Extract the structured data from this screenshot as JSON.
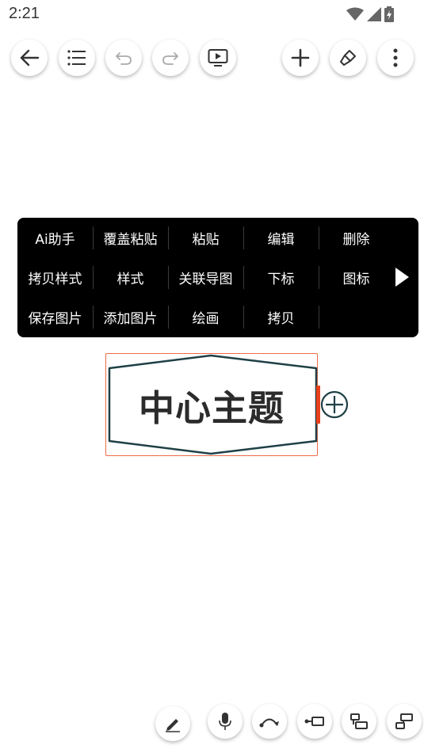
{
  "status": {
    "time": "2:21",
    "icons": [
      "wifi-icon",
      "cell-signal-icon",
      "battery-icon"
    ]
  },
  "toolbar": {
    "buttons": [
      "back-icon",
      "outline-list-icon",
      "undo-icon",
      "redo-icon",
      "present-icon",
      "add-icon",
      "format-brush-icon",
      "more-vert-icon"
    ]
  },
  "context_menu": {
    "rows": [
      [
        "Ai助手",
        "覆盖粘贴",
        "粘贴",
        "编辑",
        "删除"
      ],
      [
        "拷贝样式",
        "样式",
        "关联导图",
        "下标",
        "图标"
      ],
      [
        "保存图片",
        "添加图片",
        "绘画",
        "拷贝"
      ]
    ],
    "more_icon": "triangle-right-icon"
  },
  "node": {
    "text": "中心主题",
    "colors": {
      "border": "#1f4046",
      "selection": "#f06a4a",
      "handle": "#e8401c"
    }
  },
  "bottom_bar": {
    "buttons": [
      "pencil-icon",
      "microphone-icon",
      "relation-curve-icon",
      "add-child-node-icon",
      "add-sibling-node-icon",
      "add-parent-node-icon"
    ]
  }
}
